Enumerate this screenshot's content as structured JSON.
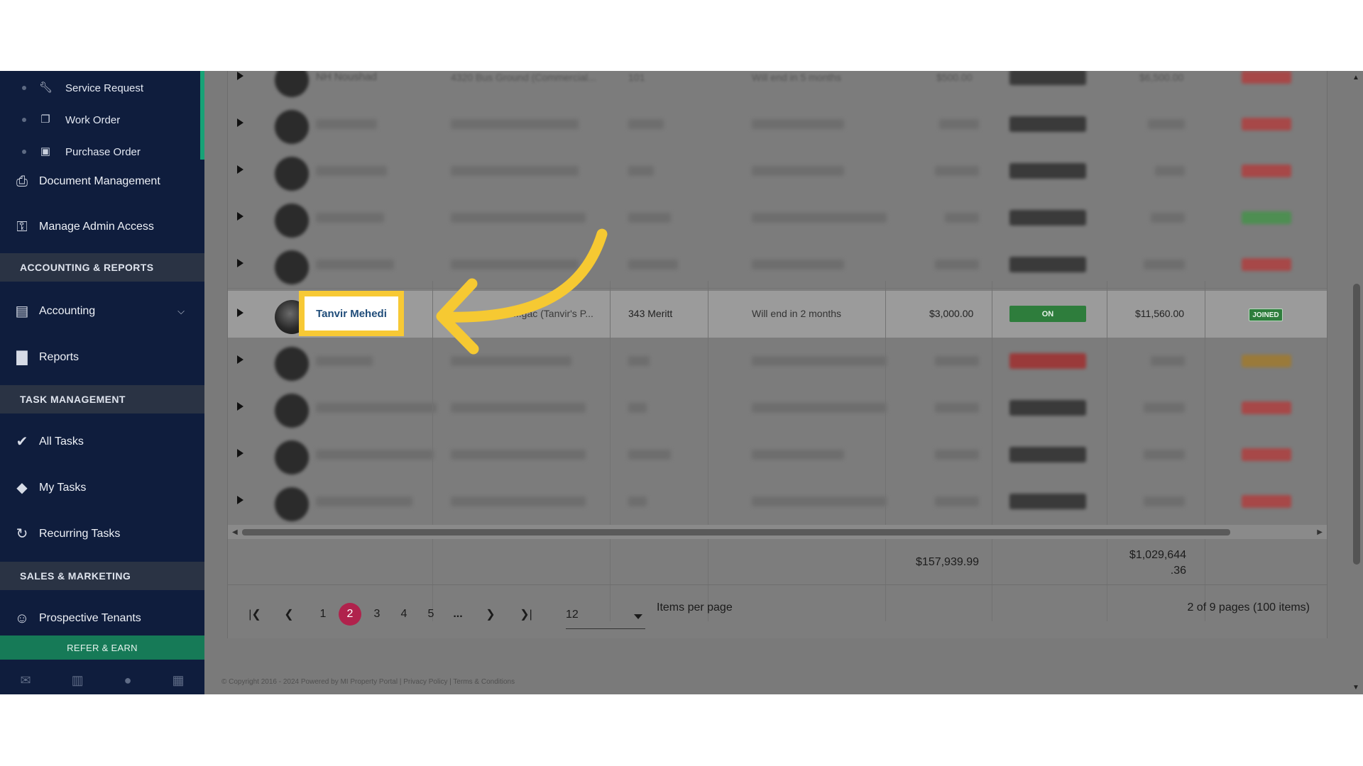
{
  "sidebar": {
    "sub_items": [
      {
        "label": "Service Request",
        "icon": "wrench-icon"
      },
      {
        "label": "Work Order",
        "icon": "documents-icon"
      },
      {
        "label": "Purchase Order",
        "icon": "truck-icon"
      }
    ],
    "items_top": [
      {
        "label": "Document Management",
        "icon": "document-management-icon"
      },
      {
        "label": "Manage Admin Access",
        "icon": "user-key-icon"
      }
    ],
    "section_accounting": "ACCOUNTING & REPORTS",
    "accounting": {
      "label": "Accounting",
      "icon": "money-icon"
    },
    "reports": {
      "label": "Reports",
      "icon": "bar-chart-icon"
    },
    "section_tasks": "TASK MANAGEMENT",
    "tasks": [
      {
        "label": "All Tasks",
        "icon": "check-icon"
      },
      {
        "label": "My Tasks",
        "icon": "tag-icon"
      },
      {
        "label": "Recurring Tasks",
        "icon": "refresh-icon"
      }
    ],
    "section_sales": "SALES & MARKETING",
    "prospective": {
      "label": "Prospective Tenants",
      "icon": "users-icon"
    },
    "refer": "REFER & EARN",
    "bottom_icons": [
      "mail-icon",
      "briefcase-icon",
      "person-icon",
      "calendar-icon"
    ]
  },
  "table": {
    "first_row_name": "NH Noushad",
    "first_row_property": "4320 Bus Ground (Commercial...",
    "first_row_unit": "101",
    "first_row_lease": "Will end in 5 months",
    "first_row_rent": "$500.00",
    "first_row_balance": "$6,500.00",
    "focus": {
      "name": "Tanvir Mehedi",
      "property": "...gac (Tanvir's P...",
      "unit": "343 Meritt",
      "lease": "Will end in 2 months",
      "rent": "$3,000.00",
      "status": "ON",
      "balance": "$11,560.00",
      "badge": "JOINED"
    }
  },
  "totals": {
    "rent_total": "$157,939.99",
    "balance_total_line1": "$1,029,644",
    "balance_total_line2": ".36"
  },
  "pager": {
    "pages": [
      "1",
      "2",
      "3",
      "4",
      "5",
      "..."
    ],
    "current": "2",
    "per_page": "12",
    "per_page_label": "Items per page",
    "info": "2 of 9 pages (100 items)"
  },
  "footer": "© Copyright 2016 - 2024 Powered by MI Property Portal | Privacy Policy | Terms & Conditions",
  "colors": {
    "sidebar_bg": "#0f1d3d",
    "accent_green": "#17a276",
    "highlight": "#f7c935",
    "active_page": "#b0224c"
  }
}
